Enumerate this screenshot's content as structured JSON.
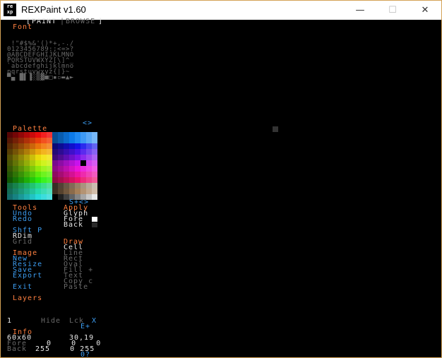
{
  "window": {
    "title": "REXPaint v1.60",
    "icon_text": "re xp",
    "controls": [
      "—",
      "☐",
      "✕"
    ]
  },
  "top_tabs": {
    "paint": "PAINT",
    "sep": "|",
    "browse": "BROWSE",
    "open": "[",
    "close": "]"
  },
  "font_panel": {
    "label": "Font",
    "rows": [
      " !\"#$%&'()*+,-./",
      "0123456789:;<=>?",
      "@ABCDEFGHIJKLMNO",
      "PQRSTUVWXYZ[\\]^_",
      "`abcdefghijklmno",
      "pqrstuvwxyz{|}~",
      "▀▄ █▌▐░▒▓■□▪▫▬▲►"
    ]
  },
  "palette_panel": {
    "label": "Palette",
    "nav": "<>",
    "bottom_nav": "S+<>"
  },
  "tools_menu": {
    "header": "Tools",
    "items": [
      "Undo",
      "Redo"
    ]
  },
  "apply_menu": {
    "header": "Apply",
    "items": [
      "Glyph",
      "Fore",
      "Back"
    ]
  },
  "view_menu": {
    "items": [
      "Shft P",
      "RDim",
      "Grid"
    ]
  },
  "draw_menu": {
    "header": "Draw",
    "items": [
      "Cell",
      "Line",
      "Rect",
      "Oval",
      "Fill +",
      "Text",
      "Copy c",
      "Paste"
    ]
  },
  "image_menu": {
    "header": "Image",
    "items": [
      "New",
      "Resize",
      "Save",
      "Export"
    ]
  },
  "exit_label": "Exit",
  "layers": {
    "header": "Layers",
    "row_number": "1",
    "hide": "Hide",
    "lock": "Lck",
    "x": "X",
    "add": "E+"
  },
  "info": {
    "header": "Info",
    "size": "60x60",
    "coords": "30,19",
    "fore_label": "Fore",
    "fore_values": "0    0    0",
    "back_label": "Back",
    "back_values": "255    0 255",
    "glyph_code": "0?"
  },
  "colors": {
    "orange": "#ff8040",
    "blue": "#3c9cf0",
    "gray": "#6a6a6a",
    "white": "#e8e8e8",
    "window_border": "#d4a256"
  }
}
